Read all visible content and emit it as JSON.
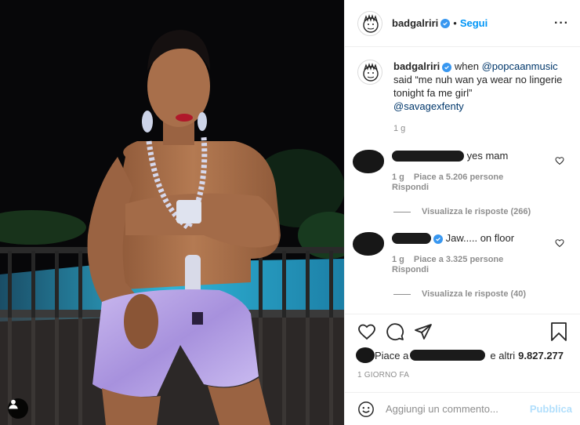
{
  "post": {
    "username": "badgalriri",
    "follow_label": "Segui",
    "separator": "•",
    "more_label": "···",
    "caption": {
      "before_mention": "when ",
      "mention": "@popcaanmusic",
      "text": " said “me nuh wan ya wear no lingerie tonight fa me girl”",
      "tag": "@savagexfenty",
      "time": "1 g"
    }
  },
  "comments": [
    {
      "text": "yes mam",
      "time": "1 g",
      "likes": "Piace a 5.206 persone",
      "reply": "Rispondi",
      "view_replies": "Visualizza le risposte (266)"
    },
    {
      "text": "Jaw..... on floor",
      "time": "1 g",
      "likes": "Piace a 3.325 persone",
      "reply": "Rispondi",
      "view_replies": "Visualizza le risposte (40)"
    }
  ],
  "likes_line": {
    "prefix": "Piace a",
    "connector": "e altri",
    "count": "9.827.277"
  },
  "posted_ago": "1 giorno fa",
  "add_comment": {
    "placeholder": "Aggiungi un commento...",
    "publish_label": "Pubblica"
  },
  "icons": {
    "verified": "verified-badge-icon",
    "heart": "heart-icon",
    "comment": "comment-icon",
    "share": "paper-plane-icon",
    "save": "bookmark-icon",
    "emoji": "emoji-icon",
    "user_tag": "user-tag-icon"
  },
  "colors": {
    "link": "#00376b",
    "follow": "#0095f6",
    "verified": "#3897f0",
    "publish_disabled": "#b2dffc"
  }
}
